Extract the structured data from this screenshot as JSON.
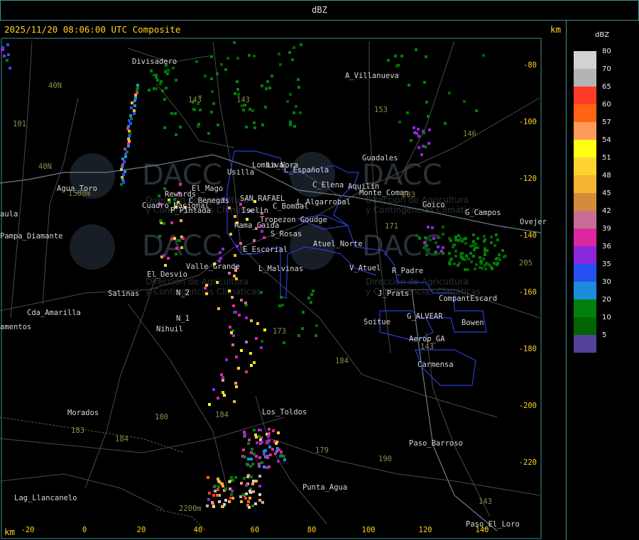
{
  "window": {
    "title": "dBZ"
  },
  "map": {
    "timestamp_label": "2025/11/20 08:06:00 UTC Composite",
    "unit_label": "km",
    "x_axis_label": "km",
    "x_ticks": [
      -20,
      0,
      20,
      40,
      60,
      80,
      100,
      120,
      140
    ],
    "y_ticks": [
      -80,
      -100,
      -120,
      -140,
      -160,
      -180,
      -200,
      -220
    ],
    "places": [
      "Divisadero",
      "A_Villanueva",
      "Agua_Toro",
      "Monte_Coman",
      "Guadales",
      "C_Española",
      "C_Elena",
      "Aquilin",
      "Goico",
      "G_Campos",
      "Ovejer",
      "SAN RAFAEL",
      "C_Bombal",
      "C_Benegas",
      "Rama_Caida",
      "Cuadro_Nacional",
      "L_Algarrobal",
      "Pampa_Diamante",
      "Cda_Amarilla",
      "El_Desvio",
      "Salinas",
      "N_2",
      "N_1",
      "Nihuil",
      "Valle_Grande",
      "L_Malvinas",
      "E_Escorial",
      "S_Rosas",
      "Atuel_Norte",
      "V_Atuel",
      "R_Padre",
      "J_Prats",
      "CompantEscard",
      "Soitue",
      "G_ALVEAR",
      "Aerop_GA",
      "Bowen",
      "Carmensa",
      "La_Nora",
      "Los_Toldos",
      "Morados",
      "Paso_Barroso",
      "Punta_Agua",
      "Lag_Llancanelo",
      "Paso_El_Loro",
      "P_Pintada",
      "Iselin",
      "Tropezon Goudge",
      "Usilla",
      "Lombiva",
      "El_Mago",
      "Rewards",
      "amentos",
      "aula"
    ],
    "routes": [
      "40N",
      "40N",
      "101",
      "143",
      "143",
      "153",
      "146",
      "171",
      "173",
      "184",
      "180",
      "184",
      "183",
      "184",
      "179",
      "190",
      "203",
      "205",
      "143",
      "143"
    ],
    "elevation_labels": [
      "1500m",
      "2200m"
    ],
    "watermark": {
      "logo": "DACC",
      "line1": "Dirección de Agricultura",
      "line2": "y Contingencias Climáticas"
    }
  },
  "legend": {
    "title": "dBZ",
    "entries": [
      {
        "value": "80",
        "color": "#d2d2d2"
      },
      {
        "value": "70",
        "color": "#b4b4b4"
      },
      {
        "value": "65",
        "color": "#ff3c28"
      },
      {
        "value": "60",
        "color": "#ff6414"
      },
      {
        "value": "57",
        "color": "#ff9b5a"
      },
      {
        "value": "54",
        "color": "#ffff14"
      },
      {
        "value": "51",
        "color": "#ffd232"
      },
      {
        "value": "48",
        "color": "#f5b432"
      },
      {
        "value": "45",
        "color": "#d28c3c"
      },
      {
        "value": "42",
        "color": "#c86e96"
      },
      {
        "value": "39",
        "color": "#dc28a0"
      },
      {
        "value": "36",
        "color": "#8c28dc"
      },
      {
        "value": "35",
        "color": "#2850f0"
      },
      {
        "value": "30",
        "color": "#1e8cdc"
      },
      {
        "value": "20",
        "color": "#00800a"
      },
      {
        "value": "10",
        "color": "#006400"
      },
      {
        "value": "5",
        "color": "#55409a"
      }
    ]
  }
}
